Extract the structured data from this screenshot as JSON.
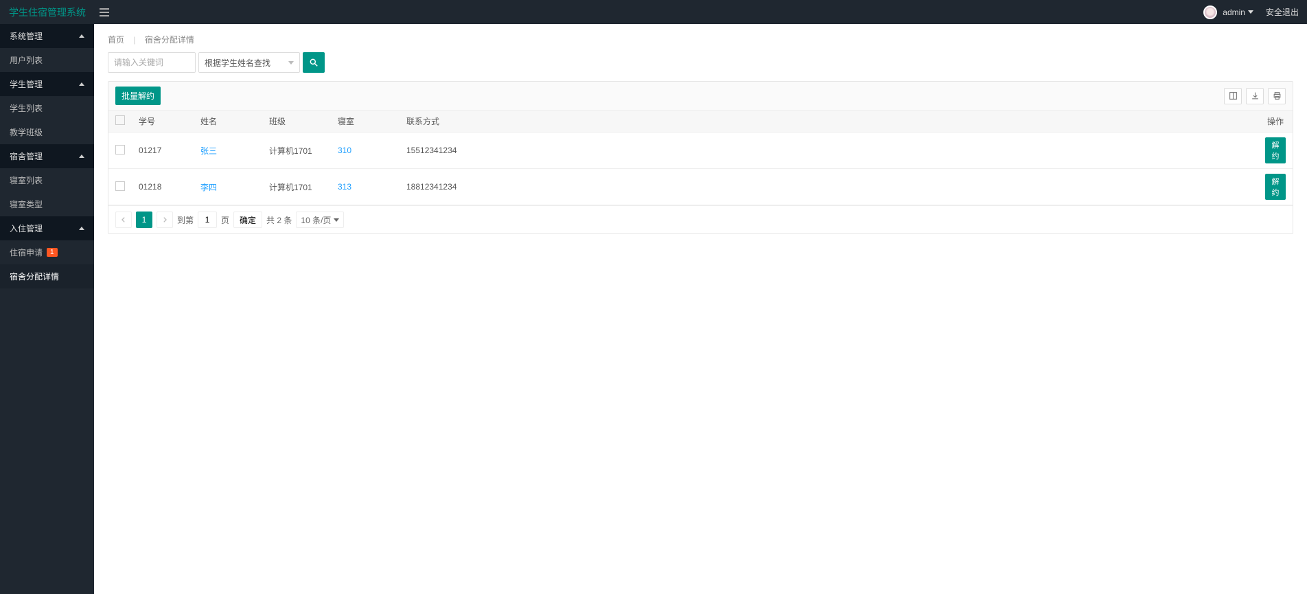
{
  "brand": "学生住宿管理系统",
  "header": {
    "username": "admin",
    "logout": "安全退出"
  },
  "sidebar": {
    "groups": [
      {
        "label": "系统管理",
        "items": [
          {
            "label": "用户列表",
            "badge": null,
            "active": false
          }
        ]
      },
      {
        "label": "学生管理",
        "items": [
          {
            "label": "学生列表",
            "badge": null,
            "active": false
          },
          {
            "label": "教学班级",
            "badge": null,
            "active": false
          }
        ]
      },
      {
        "label": "宿舍管理",
        "items": [
          {
            "label": "寝室列表",
            "badge": null,
            "active": false
          },
          {
            "label": "寝室类型",
            "badge": null,
            "active": false
          }
        ]
      },
      {
        "label": "入住管理",
        "items": [
          {
            "label": "住宿申请",
            "badge": "1",
            "active": false
          },
          {
            "label": "宿舍分配详情",
            "badge": null,
            "active": true
          }
        ]
      }
    ]
  },
  "breadcrumb": {
    "home": "首页",
    "current": "宿舍分配详情"
  },
  "search": {
    "placeholder": "请输入关键词",
    "select_label": "根据学生姓名查找"
  },
  "toolbar": {
    "batch_label": "批量解约"
  },
  "table": {
    "headers": {
      "sid": "学号",
      "name": "姓名",
      "class": "班级",
      "room": "寝室",
      "phone": "联系方式",
      "op": "操作"
    },
    "rows": [
      {
        "sid": "01217",
        "name": "张三",
        "class": "计算机1701",
        "room": "310",
        "phone": "15512341234",
        "op": "解约"
      },
      {
        "sid": "01218",
        "name": "李四",
        "class": "计算机1701",
        "room": "313",
        "phone": "18812341234",
        "op": "解约"
      }
    ]
  },
  "pager": {
    "page": "1",
    "goto_prefix": "到第",
    "goto_value": "1",
    "goto_suffix": "页",
    "confirm": "确定",
    "total": "共 2 条",
    "page_size": "10 条/页"
  }
}
